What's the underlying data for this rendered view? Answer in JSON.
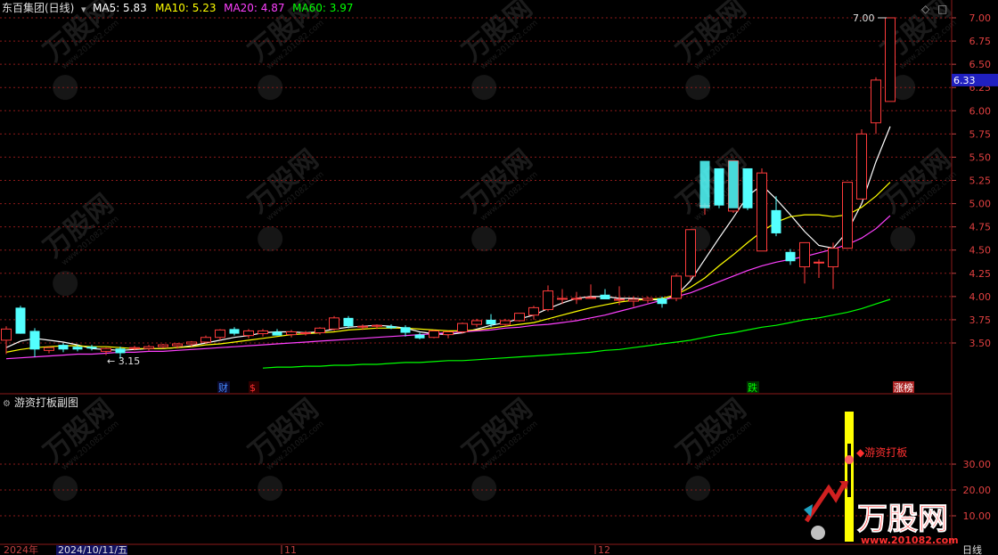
{
  "header": {
    "title": "东百集团(日线)",
    "ma_labels": [
      {
        "text": "MA5: 5.83",
        "color": "#ffffff"
      },
      {
        "text": "MA10: 5.23",
        "color": "#ffff00"
      },
      {
        "text": "MA20: 4.87",
        "color": "#ff40ff"
      },
      {
        "text": "MA60: 3.97",
        "color": "#00ff00"
      }
    ],
    "corner_icons": [
      "diamond-icon",
      "restore-icon"
    ]
  },
  "sub_panel": {
    "title": "游资打板副图",
    "signal_label": "游资打板",
    "y_ticks": [
      "30.00",
      "20.00",
      "10.00"
    ]
  },
  "footer": {
    "year_label": "2024年",
    "date_label": "2024/10/11/五",
    "month_ticks": [
      "11",
      "12"
    ],
    "period_label": "日线"
  },
  "watermark": {
    "brand": "万股网",
    "url": "www.201082.com"
  },
  "event_tags": [
    {
      "label": "财",
      "color": "#4488ff",
      "bg": "#0a0a30"
    },
    {
      "label": "$",
      "color": "#ff3030",
      "bg": "#300000"
    },
    {
      "label": "跌",
      "color": "#00ff00",
      "bg": "#003000"
    },
    {
      "label": "涨榜",
      "color": "#ffffff",
      "bg": "#aa2222"
    }
  ],
  "price_tag": {
    "value": "6.33",
    "color": "#2020c0"
  },
  "chart_data": {
    "type": "candlestick",
    "title": "东百集团(日线)",
    "y_ticks": [
      "7.00",
      "6.75",
      "6.50",
      "6.25",
      "6.00",
      "5.75",
      "5.50",
      "5.25",
      "5.00",
      "4.75",
      "4.50",
      "4.25",
      "4.00",
      "3.75",
      "3.50"
    ],
    "ylim": [
      3.2,
      7.1
    ],
    "high_label": "7.00",
    "low_label": "3.15",
    "colors": {
      "up": "#ff3b3b",
      "down": "#54ffff",
      "grid": "#8b1a1a"
    },
    "candles": [
      {
        "o": 3.53,
        "h": 3.68,
        "l": 3.38,
        "c": 3.65
      },
      {
        "o": 3.88,
        "h": 3.9,
        "l": 3.6,
        "c": 3.6
      },
      {
        "o": 3.63,
        "h": 3.66,
        "l": 3.35,
        "c": 3.43
      },
      {
        "o": 3.42,
        "h": 3.46,
        "l": 3.39,
        "c": 3.45
      },
      {
        "o": 3.48,
        "h": 3.5,
        "l": 3.4,
        "c": 3.43
      },
      {
        "o": 3.46,
        "h": 3.48,
        "l": 3.41,
        "c": 3.43
      },
      {
        "o": 3.46,
        "h": 3.48,
        "l": 3.42,
        "c": 3.44
      },
      {
        "o": 3.41,
        "h": 3.45,
        "l": 3.37,
        "c": 3.44
      },
      {
        "o": 3.44,
        "h": 3.46,
        "l": 3.33,
        "c": 3.39
      },
      {
        "o": 3.44,
        "h": 3.47,
        "l": 3.42,
        "c": 3.45
      },
      {
        "o": 3.44,
        "h": 3.48,
        "l": 3.42,
        "c": 3.46
      },
      {
        "o": 3.46,
        "h": 3.49,
        "l": 3.44,
        "c": 3.48
      },
      {
        "o": 3.47,
        "h": 3.5,
        "l": 3.44,
        "c": 3.49
      },
      {
        "o": 3.49,
        "h": 3.52,
        "l": 3.46,
        "c": 3.51
      },
      {
        "o": 3.51,
        "h": 3.58,
        "l": 3.49,
        "c": 3.56
      },
      {
        "o": 3.56,
        "h": 3.65,
        "l": 3.53,
        "c": 3.64
      },
      {
        "o": 3.65,
        "h": 3.67,
        "l": 3.58,
        "c": 3.6
      },
      {
        "o": 3.58,
        "h": 3.65,
        "l": 3.55,
        "c": 3.63
      },
      {
        "o": 3.6,
        "h": 3.65,
        "l": 3.57,
        "c": 3.63
      },
      {
        "o": 3.62,
        "h": 3.65,
        "l": 3.58,
        "c": 3.58
      },
      {
        "o": 3.59,
        "h": 3.64,
        "l": 3.56,
        "c": 3.62
      },
      {
        "o": 3.6,
        "h": 3.63,
        "l": 3.58,
        "c": 3.61
      },
      {
        "o": 3.61,
        "h": 3.67,
        "l": 3.59,
        "c": 3.66
      },
      {
        "o": 3.65,
        "h": 3.79,
        "l": 3.63,
        "c": 3.77
      },
      {
        "o": 3.77,
        "h": 3.79,
        "l": 3.66,
        "c": 3.68
      },
      {
        "o": 3.68,
        "h": 3.7,
        "l": 3.64,
        "c": 3.68
      },
      {
        "o": 3.68,
        "h": 3.7,
        "l": 3.65,
        "c": 3.69
      },
      {
        "o": 3.68,
        "h": 3.7,
        "l": 3.65,
        "c": 3.66
      },
      {
        "o": 3.67,
        "h": 3.69,
        "l": 3.57,
        "c": 3.61
      },
      {
        "o": 3.59,
        "h": 3.61,
        "l": 3.54,
        "c": 3.55
      },
      {
        "o": 3.56,
        "h": 3.64,
        "l": 3.55,
        "c": 3.63
      },
      {
        "o": 3.59,
        "h": 3.63,
        "l": 3.55,
        "c": 3.62
      },
      {
        "o": 3.62,
        "h": 3.72,
        "l": 3.6,
        "c": 3.71
      },
      {
        "o": 3.7,
        "h": 3.76,
        "l": 3.67,
        "c": 3.74
      },
      {
        "o": 3.75,
        "h": 3.81,
        "l": 3.67,
        "c": 3.7
      },
      {
        "o": 3.7,
        "h": 3.76,
        "l": 3.68,
        "c": 3.74
      },
      {
        "o": 3.74,
        "h": 3.82,
        "l": 3.73,
        "c": 3.82
      },
      {
        "o": 3.8,
        "h": 3.9,
        "l": 3.75,
        "c": 3.88
      },
      {
        "o": 3.86,
        "h": 4.12,
        "l": 3.84,
        "c": 4.06
      },
      {
        "o": 3.98,
        "h": 4.08,
        "l": 3.92,
        "c": 3.98
      },
      {
        "o": 3.98,
        "h": 4.05,
        "l": 3.92,
        "c": 3.98
      },
      {
        "o": 3.98,
        "h": 4.13,
        "l": 3.98,
        "c": 3.99
      },
      {
        "o": 4.02,
        "h": 4.08,
        "l": 3.98,
        "c": 3.97
      },
      {
        "o": 3.97,
        "h": 4.11,
        "l": 3.91,
        "c": 3.97
      },
      {
        "o": 3.95,
        "h": 4.0,
        "l": 3.89,
        "c": 3.97
      },
      {
        "o": 3.96,
        "h": 4.0,
        "l": 3.93,
        "c": 3.98
      },
      {
        "o": 3.98,
        "h": 4.0,
        "l": 3.88,
        "c": 3.92
      },
      {
        "o": 3.98,
        "h": 4.25,
        "l": 3.95,
        "c": 4.22
      },
      {
        "o": 4.22,
        "h": 4.72,
        "l": 4.18,
        "c": 4.72
      },
      {
        "o": 4.98,
        "h": 5.0,
        "l": 4.88,
        "c": 4.98
      },
      {
        "o": 5.38,
        "h": 5.38,
        "l": 4.95,
        "c": 4.98
      },
      {
        "o": 4.92,
        "h": 5.46,
        "l": 4.9,
        "c": 5.46
      },
      {
        "o": 5.38,
        "h": 5.38,
        "l": 4.93,
        "c": 4.95
      },
      {
        "o": 4.49,
        "h": 5.38,
        "l": 4.49,
        "c": 5.33
      },
      {
        "o": 4.93,
        "h": 5.08,
        "l": 4.65,
        "c": 4.68
      },
      {
        "o": 4.48,
        "h": 4.51,
        "l": 4.34,
        "c": 4.38
      },
      {
        "o": 4.32,
        "h": 4.58,
        "l": 4.14,
        "c": 4.58
      },
      {
        "o": 4.37,
        "h": 4.4,
        "l": 4.2,
        "c": 4.37
      },
      {
        "o": 4.32,
        "h": 4.58,
        "l": 4.08,
        "c": 4.52
      },
      {
        "o": 4.52,
        "h": 5.23,
        "l": 4.52,
        "c": 5.23
      },
      {
        "o": 5.05,
        "h": 5.8,
        "l": 5.05,
        "c": 5.75
      },
      {
        "o": 5.87,
        "h": 6.36,
        "l": 5.75,
        "c": 6.33
      },
      {
        "o": 6.1,
        "h": 7.0,
        "l": 6.1,
        "c": 7.0
      }
    ],
    "ma_series": [
      {
        "name": "MA5",
        "color": "#ffffff",
        "values": [
          3.45,
          3.52,
          3.55,
          3.53,
          3.51,
          3.48,
          3.44,
          3.43,
          3.42,
          3.43,
          3.44,
          3.44,
          3.45,
          3.47,
          3.5,
          3.53,
          3.56,
          3.58,
          3.61,
          3.62,
          3.62,
          3.61,
          3.62,
          3.65,
          3.67,
          3.68,
          3.69,
          3.68,
          3.66,
          3.62,
          3.6,
          3.59,
          3.61,
          3.65,
          3.69,
          3.72,
          3.76,
          3.8,
          3.87,
          3.93,
          3.98,
          4.0,
          4.0,
          3.98,
          3.98,
          3.97,
          3.96,
          4.01,
          4.17,
          4.4,
          4.63,
          4.85,
          5.08,
          5.2,
          5.05,
          4.88,
          4.7,
          4.55,
          4.52,
          4.7,
          5.0,
          5.45,
          5.83
        ]
      },
      {
        "name": "MA10",
        "color": "#ffff00",
        "values": [
          3.4,
          3.43,
          3.45,
          3.46,
          3.47,
          3.47,
          3.46,
          3.46,
          3.45,
          3.44,
          3.44,
          3.44,
          3.45,
          3.46,
          3.48,
          3.49,
          3.51,
          3.53,
          3.55,
          3.57,
          3.59,
          3.6,
          3.61,
          3.62,
          3.64,
          3.65,
          3.66,
          3.66,
          3.66,
          3.65,
          3.64,
          3.63,
          3.63,
          3.64,
          3.66,
          3.68,
          3.7,
          3.72,
          3.76,
          3.8,
          3.84,
          3.88,
          3.91,
          3.94,
          3.96,
          3.97,
          3.98,
          4.02,
          4.1,
          4.2,
          4.33,
          4.45,
          4.58,
          4.7,
          4.8,
          4.86,
          4.88,
          4.88,
          4.86,
          4.88,
          4.96,
          5.08,
          5.23
        ]
      },
      {
        "name": "MA20",
        "color": "#ff40ff",
        "values": [
          3.33,
          3.34,
          3.35,
          3.36,
          3.37,
          3.38,
          3.38,
          3.39,
          3.4,
          3.4,
          3.41,
          3.41,
          3.42,
          3.43,
          3.44,
          3.45,
          3.46,
          3.47,
          3.48,
          3.49,
          3.5,
          3.51,
          3.52,
          3.53,
          3.54,
          3.55,
          3.56,
          3.57,
          3.58,
          3.59,
          3.6,
          3.61,
          3.62,
          3.63,
          3.64,
          3.66,
          3.67,
          3.69,
          3.7,
          3.72,
          3.74,
          3.77,
          3.8,
          3.84,
          3.88,
          3.92,
          3.96,
          4.0,
          4.04,
          4.1,
          4.16,
          4.22,
          4.28,
          4.33,
          4.37,
          4.4,
          4.43,
          4.47,
          4.51,
          4.56,
          4.63,
          4.73,
          4.87
        ]
      },
      {
        "name": "MA60",
        "color": "#00ff00",
        "values": [
          null,
          null,
          null,
          null,
          null,
          null,
          null,
          null,
          null,
          null,
          null,
          null,
          null,
          null,
          null,
          null,
          null,
          null,
          3.23,
          3.24,
          3.24,
          3.25,
          3.25,
          3.26,
          3.26,
          3.27,
          3.27,
          3.28,
          3.29,
          3.29,
          3.3,
          3.31,
          3.31,
          3.32,
          3.33,
          3.34,
          3.35,
          3.36,
          3.37,
          3.38,
          3.39,
          3.4,
          3.42,
          3.43,
          3.45,
          3.47,
          3.49,
          3.51,
          3.53,
          3.56,
          3.59,
          3.61,
          3.64,
          3.67,
          3.69,
          3.72,
          3.75,
          3.77,
          3.8,
          3.83,
          3.87,
          3.92,
          3.97
        ]
      }
    ],
    "sub_ylim": [
      0,
      40
    ],
    "sub_signal_bar": {
      "from": 0,
      "to": 38
    }
  }
}
